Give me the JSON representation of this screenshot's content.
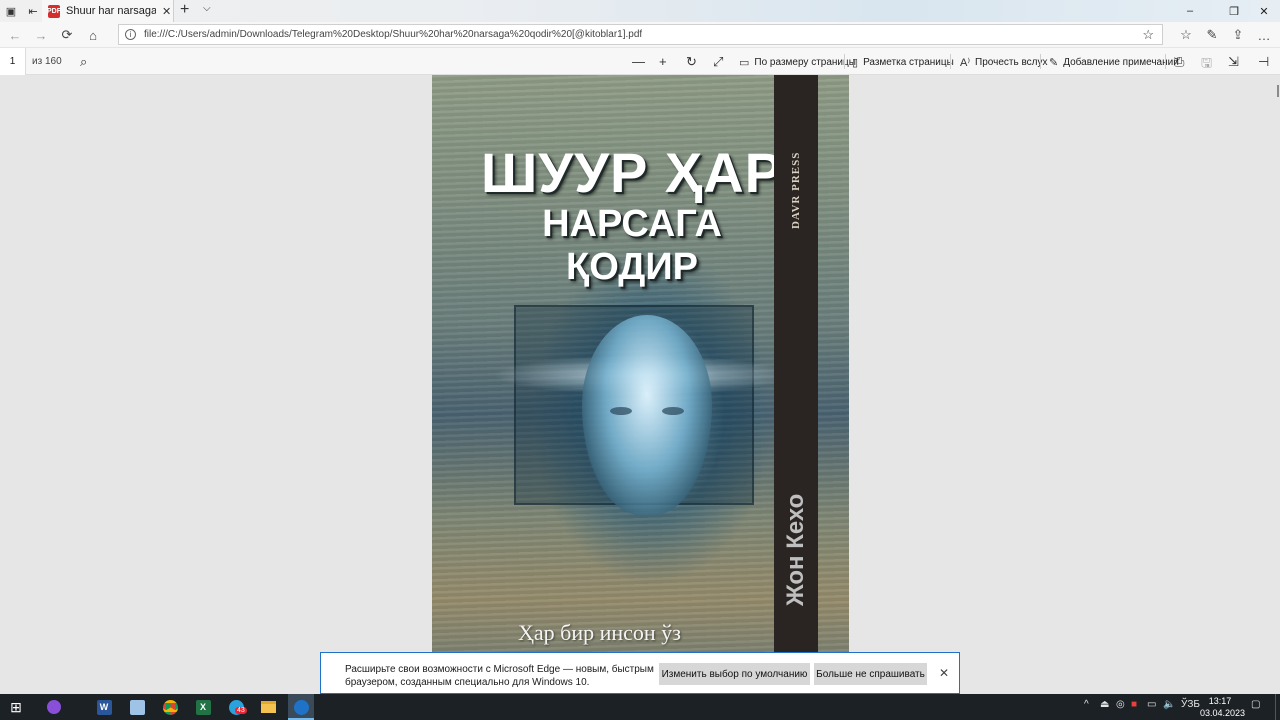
{
  "browser": {
    "tab_title": "Shuur har narsaga qodir",
    "pdf_icon": "PDF",
    "url": "file:///C:/Users/admin/Downloads/Telegram%20Desktop/Shuur%20har%20narsaga%20qodir%20[@kitoblar1].pdf",
    "tab_close": "✕",
    "new_tab": "+",
    "tab_list": "⌵"
  },
  "window_controls": {
    "minimize": "–",
    "maximize": "❐",
    "close": "✕"
  },
  "nav": {
    "back": "←",
    "forward": "→",
    "refresh": "⟳",
    "home": "⌂",
    "favorites": "☆",
    "favorites_bar": "☆",
    "notes": "✎",
    "share": "⇪",
    "more": "…"
  },
  "pdf_toolbar": {
    "page_number": "1",
    "page_total": "из 160",
    "zoom_out": "—",
    "zoom_in": "+",
    "rotate": "↻",
    "fullscreen": "⤢",
    "fit_page": "По размеру страницы",
    "page_layout": "Разметка страницы",
    "read_aloud": "Прочесть вслух",
    "add_notes": "Добавление примечаний",
    "print": "⎙",
    "save": "🖫",
    "save_as": "⇲",
    "pin": "⊣"
  },
  "cover": {
    "title_line1": "ШУУР ҲАР",
    "title_line2": "НАРСАГА ҚОДИР",
    "publisher": "DAVR PRESS",
    "author": "Жон Кехо",
    "bottom_text": "Ҳар бир инсон ўз"
  },
  "notification": {
    "text": "Расширьте свои возможности с Microsoft Edge — новым, быстрым браузером, созданным специально для Windows 10.",
    "change_default_button": "Изменить выбор по умолчанию",
    "dont_ask_button": "Больше не спрашивать",
    "close": "✕"
  },
  "taskbar": {
    "start": "⊞",
    "telegram_badge": "43",
    "tray_chevron": "^",
    "language": "ЎЗБ",
    "time": "13:17",
    "date": "03.04.2023"
  }
}
